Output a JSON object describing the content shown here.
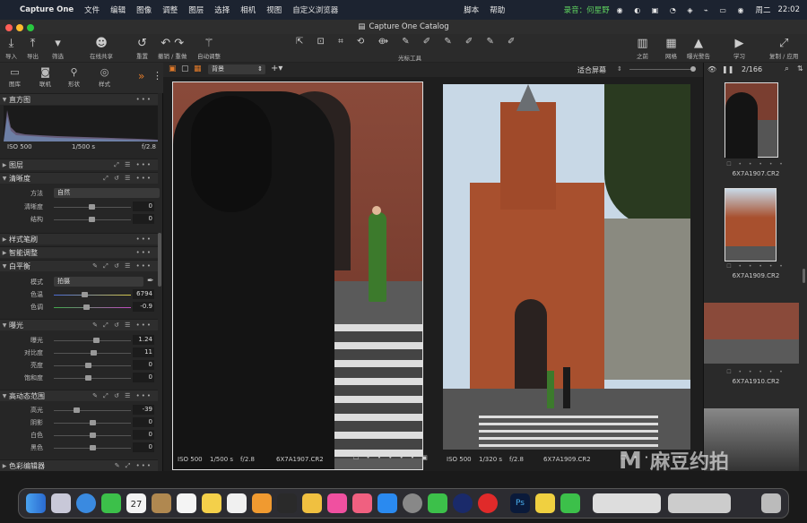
{
  "menubar": {
    "items": [
      "Capture One",
      "文件",
      "编辑",
      "图像",
      "调整",
      "图层",
      "选择",
      "相机",
      "视图",
      "自定义浏览器"
    ],
    "right_items": [
      "脚本",
      "帮助"
    ],
    "recording": "录音：何星野",
    "date": "周二",
    "time": "22:02"
  },
  "window": {
    "title": "Capture One Catalog"
  },
  "toolbar": {
    "left": [
      "导入",
      "导出",
      "筛选",
      "在线共享",
      "重置",
      "撤销 / 重做",
      "自动调整"
    ],
    "center": "光标工具",
    "right": [
      "之前",
      "网格",
      "曝光警告",
      "学习",
      "复制 / 应用"
    ]
  },
  "tool_tabs": [
    "图库",
    "联机",
    "形状",
    "样式"
  ],
  "histogram": {
    "iso": "ISO 500",
    "shutter": "1/500 s",
    "aperture": "f/2.8"
  },
  "sections": {
    "histogram": "直方图",
    "layers": "图层",
    "clarity": "清晰度",
    "style_brush": "样式笔刷",
    "smart_adjust": "智能调整",
    "white_balance": "白平衡",
    "exposure": "曝光",
    "hdr": "高动态范围",
    "color_editor": "色彩编辑器"
  },
  "clarity": {
    "method_label": "方法",
    "method_value": "自然",
    "clarity_label": "清晰度",
    "clarity_value": "0",
    "structure_label": "结构",
    "structure_value": "0"
  },
  "white_balance": {
    "mode_label": "模式",
    "mode_value": "拍摄",
    "temp_label": "色温",
    "temp_value": "6794",
    "tint_label": "色调",
    "tint_value": "-0.9"
  },
  "exposure": {
    "exposure_label": "曝光",
    "exposure_value": "1.24",
    "contrast_label": "对比度",
    "contrast_value": "11",
    "brightness_label": "亮度",
    "brightness_value": "0",
    "saturation_label": "饱和度",
    "saturation_value": "0"
  },
  "hdr": {
    "highlight_label": "高光",
    "highlight_value": "-39",
    "shadow_label": "阴影",
    "shadow_value": "0",
    "white_label": "白色",
    "white_value": "0",
    "black_label": "黑色",
    "black_value": "0"
  },
  "viewer": {
    "layer_select": "背景",
    "fit": "适合屏幕",
    "counter": "2/166",
    "left_image": {
      "iso": "ISO 500",
      "shutter": "1/500 s",
      "aperture": "f/2.8",
      "name": "6X7A1907.CR2"
    },
    "right_image": {
      "iso": "ISO 500",
      "shutter": "1/320 s",
      "aperture": "f/2.8",
      "name": "6X7A1909.CR2"
    }
  },
  "browser": {
    "thumbs": [
      "6X7A1907.CR2",
      "6X7A1909.CR2",
      "6X7A1910.CR2"
    ]
  },
  "watermark": "麻豆约拍",
  "colors": {
    "accent": "#e07a2a",
    "menubar": "#1c2330",
    "panel": "#262626"
  }
}
